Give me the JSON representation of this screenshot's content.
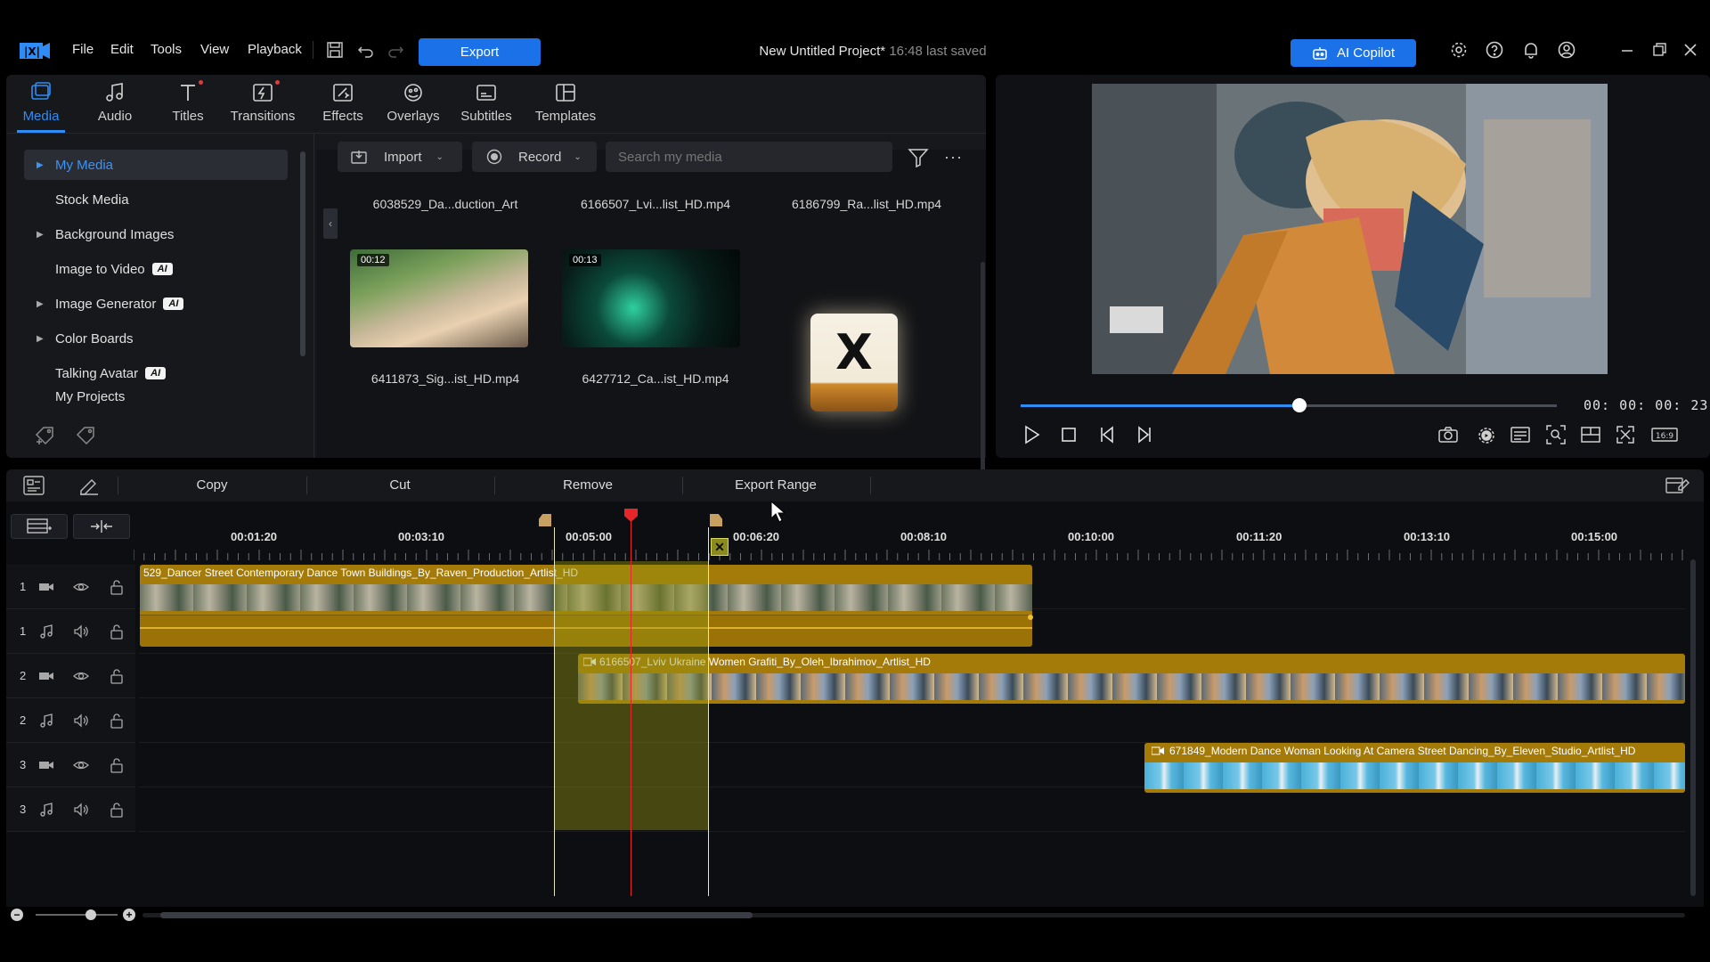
{
  "menu": {
    "file": "File",
    "edit": "Edit",
    "tools": "Tools",
    "view": "View",
    "playback": "Playback",
    "export": "Export"
  },
  "project": {
    "title": "New Untitled Project*",
    "saved": "16:48 last saved"
  },
  "ai_copilot": "AI Copilot",
  "media_tabs": [
    {
      "label": "Media",
      "icon": "media-icon"
    },
    {
      "label": "Audio",
      "icon": "music-note-icon"
    },
    {
      "label": "Titles",
      "icon": "title-t-icon"
    },
    {
      "label": "Transitions",
      "icon": "transitions-icon"
    },
    {
      "label": "Effects",
      "icon": "effects-icon"
    },
    {
      "label": "Overlays",
      "icon": "overlays-icon"
    },
    {
      "label": "Subtitles",
      "icon": "subtitles-icon"
    },
    {
      "label": "Templates",
      "icon": "templates-icon"
    }
  ],
  "sidebar": {
    "items": [
      {
        "label": "My Media"
      },
      {
        "label": "Stock Media"
      },
      {
        "label": "Background Images"
      },
      {
        "label": "Image to Video",
        "badge": "AI"
      },
      {
        "label": "Image Generator",
        "badge": "AI"
      },
      {
        "label": "Color Boards"
      },
      {
        "label": "Talking Avatar",
        "badge": "AI"
      },
      {
        "label": "My Projects"
      }
    ]
  },
  "media_controls": {
    "import": "Import",
    "record": "Record",
    "search_placeholder": "Search my media"
  },
  "media_files": [
    {
      "name": "6038529_Da...duction_Art"
    },
    {
      "name": "6166507_Lvi...list_HD.mp4"
    },
    {
      "name": "6186799_Ra...list_HD.mp4"
    },
    {
      "name": "6411873_Sig...ist_HD.mp4",
      "duration": "00:12"
    },
    {
      "name": "6427712_Ca...ist_HD.mp4",
      "duration": "00:13"
    }
  ],
  "drag_icon_letter": "X",
  "preview": {
    "timecode": "00: 00: 00: 23",
    "progress": 0.52,
    "aspect": "16:9"
  },
  "edit_toolbar": {
    "copy": "Copy",
    "cut": "Cut",
    "remove": "Remove",
    "export_range": "Export Range"
  },
  "ruler_labels": [
    "00:01:20",
    "00:03:10",
    "00:05:00",
    "00:06:20",
    "00:08:10",
    "00:10:00",
    "00:11:20",
    "00:13:10",
    "00:15:00"
  ],
  "tracks": [
    {
      "num": "1",
      "kind": "video"
    },
    {
      "num": "1",
      "kind": "audio"
    },
    {
      "num": "2",
      "kind": "video"
    },
    {
      "num": "2",
      "kind": "audio"
    },
    {
      "num": "3",
      "kind": "video"
    },
    {
      "num": "3",
      "kind": "audio"
    }
  ],
  "clips": {
    "clip1": "529_Dancer Street Contemporary Dance Town Buildings_By_Raven_Production_Artlist_HD",
    "clip2": "6166507_Lviv Ukraine Women Grafiti_By_Oleh_Ibrahimov_Artlist_HD",
    "clip3": "671849_Modern Dance Woman Looking At Camera Street Dancing_By_Eleven_Studio_Artlist_HD"
  },
  "colors": {
    "accent": "#1b72e8",
    "clip_gold": "#b8860b",
    "playhead": "#e8262a",
    "range_fill": "#6b6a12"
  }
}
